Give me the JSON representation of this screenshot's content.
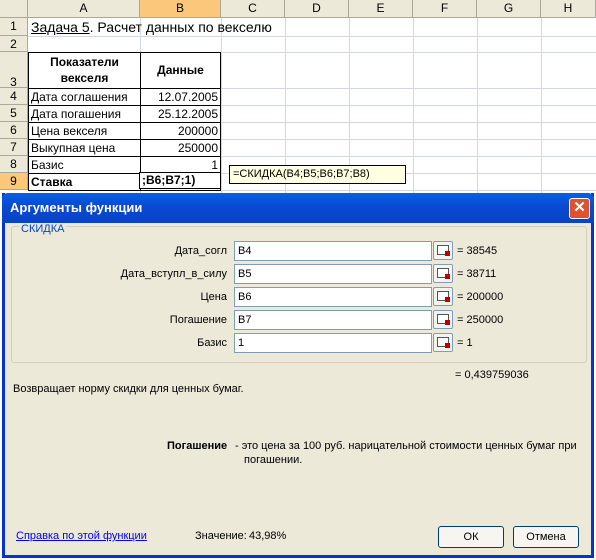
{
  "spreadsheet": {
    "columns": [
      "A",
      "B",
      "C",
      "D",
      "E",
      "F",
      "G",
      "H"
    ],
    "rows": [
      "1",
      "2",
      "3",
      "4",
      "5",
      "6",
      "7",
      "8",
      "9"
    ],
    "title_prefix": "Задача 5",
    "title_rest": ". Расчет данных по векселю",
    "header_col_a": "Показатели векселя",
    "header_col_b": "Данные",
    "data_rows": [
      {
        "label": "Дата соглашения",
        "value": "12.07.2005"
      },
      {
        "label": "Дата погашения",
        "value": "25.12.2005"
      },
      {
        "label": "Цена векселя",
        "value": "200000"
      },
      {
        "label": "Выкупная цена",
        "value": "250000"
      },
      {
        "label": "Базис",
        "value": "1"
      }
    ],
    "row9_label": "Ставка",
    "cell_edit_text": ";B6;B7;1)",
    "formula_tooltip": "=СКИДКА(B4;B5;B6;B7;B8)"
  },
  "dialog": {
    "title": "Аргументы функции",
    "close_glyph": "✕",
    "function_name": "СКИДКА",
    "args": [
      {
        "name": "Дата_согл",
        "input": "B4",
        "result": "= 38545"
      },
      {
        "name": "Дата_вступл_в_силу",
        "input": "B5",
        "result": "= 38711"
      },
      {
        "name": "Цена",
        "input": "B6",
        "result": "= 200000"
      },
      {
        "name": "Погашение",
        "input": "B7",
        "result": "= 250000"
      },
      {
        "name": "Базис",
        "input": "1",
        "result": "= 1"
      }
    ],
    "total_result": "= 0,439759036",
    "description": "Возвращает норму скидки для ценных бумаг.",
    "arg_help_name": "Погашение",
    "arg_help_text_1": "- это цена за 100 руб. нарицательной стоимости ценных бумаг при",
    "arg_help_text_2": "погашении.",
    "help_link": "Справка по этой функции",
    "value_label": "Значение:",
    "value": "43,98%",
    "ok_label": "ОК",
    "cancel_label": "Отмена"
  },
  "colors": {
    "title_bar": "#0a50d6",
    "selected_header": "#fbc77b",
    "link": "#0000ff",
    "group_label": "#0046d5"
  }
}
